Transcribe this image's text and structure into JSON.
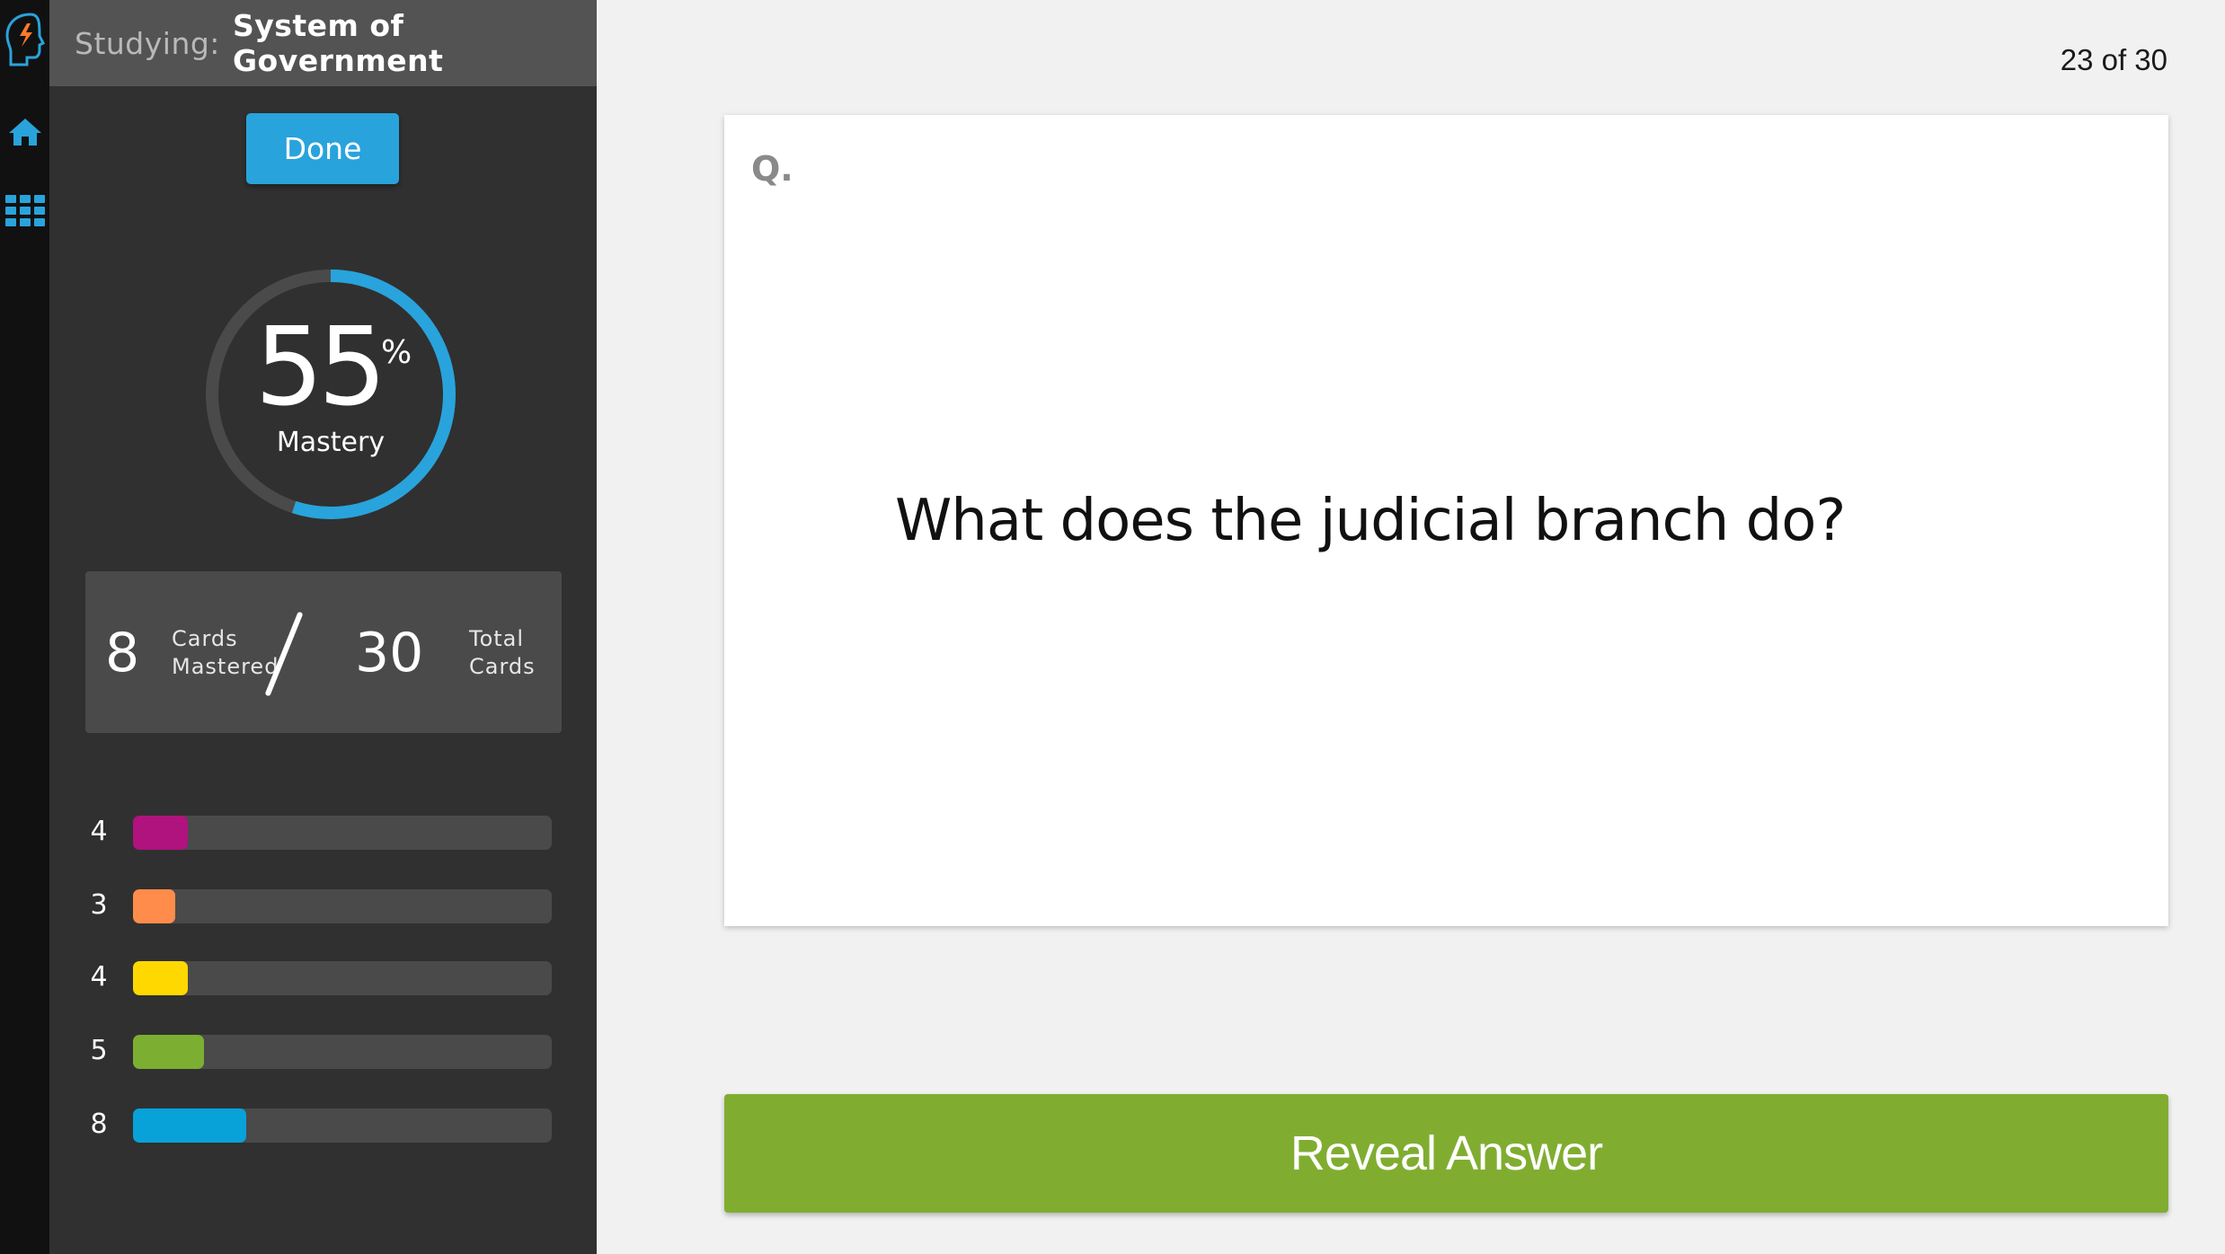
{
  "rail": {
    "icons": [
      "brain-logo-icon",
      "home-icon",
      "grid-icon"
    ],
    "accent": "#29a3dc"
  },
  "sidebar": {
    "studying_label": "Studying:",
    "topic": "System of Government",
    "done_label": "Done",
    "mastery": {
      "value": "55",
      "percent_sign": "%",
      "label": "Mastery",
      "fraction": 0.55
    },
    "cards": {
      "mastered": "8",
      "mastered_label_1": "Cards",
      "mastered_label_2": "Mastered",
      "total": "30",
      "total_label_1": "Total",
      "total_label_2": "Cards"
    },
    "levels": [
      {
        "count": "4",
        "color": "#b0127e",
        "fraction": 0.13
      },
      {
        "count": "3",
        "color": "#ff8c4a",
        "fraction": 0.1
      },
      {
        "count": "4",
        "color": "#ffd800",
        "fraction": 0.13
      },
      {
        "count": "5",
        "color": "#7cae32",
        "fraction": 0.17
      },
      {
        "count": "8",
        "color": "#08a2d8",
        "fraction": 0.27
      }
    ]
  },
  "main": {
    "counter": "23 of 30",
    "q_label": "Q.",
    "question": "What does the judicial branch do?",
    "reveal_label": "Reveal Answer"
  }
}
